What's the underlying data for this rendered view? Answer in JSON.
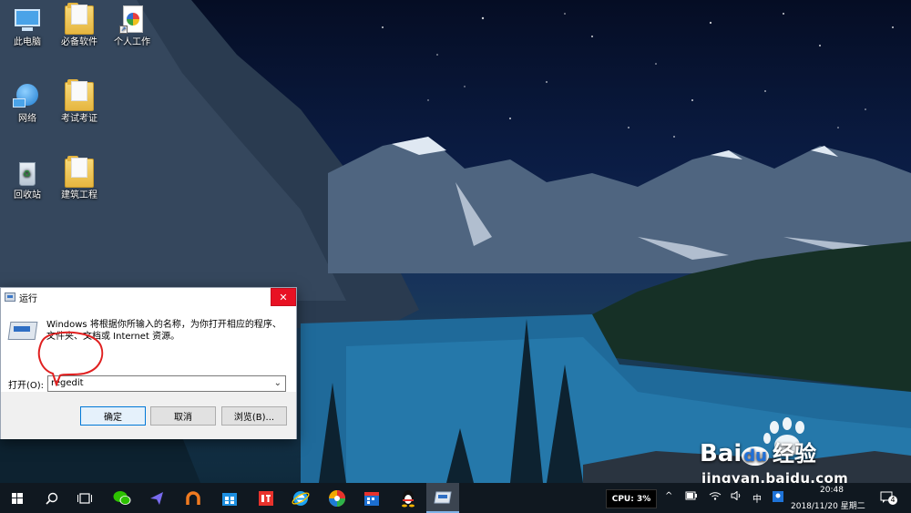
{
  "desktop": {
    "icons": [
      {
        "label": "此电脑"
      },
      {
        "label": "必备软件"
      },
      {
        "label": "个人工作"
      },
      {
        "label": "网络"
      },
      {
        "label": "考试考证"
      },
      {
        "label": "回收站"
      },
      {
        "label": "建筑工程"
      }
    ]
  },
  "run_dialog": {
    "title": "运行",
    "close_glyph": "✕",
    "description": "Windows 将根据你所输入的名称，为你打开相应的程序、文件夹、文档或 Internet 资源。",
    "open_label": "打开(O):",
    "open_value": "regedit",
    "ok_label": "确定",
    "cancel_label": "取消",
    "browse_label": "浏览(B)..."
  },
  "watermark": {
    "brand": "Bai",
    "brand2": "du",
    "cn": "经验",
    "url": "jingyan.baidu.com"
  },
  "taskbar": {
    "cpu_label": "CPU:",
    "cpu_value": "3%",
    "ime": "中",
    "time": "20:48",
    "date": "2018/11/20 星期二",
    "notification_count": "4"
  },
  "colors": {
    "taskbar_bg": "#101820",
    "close_red": "#e81123",
    "annotation_red": "#e02020",
    "accent_blue": "#0078d7"
  }
}
